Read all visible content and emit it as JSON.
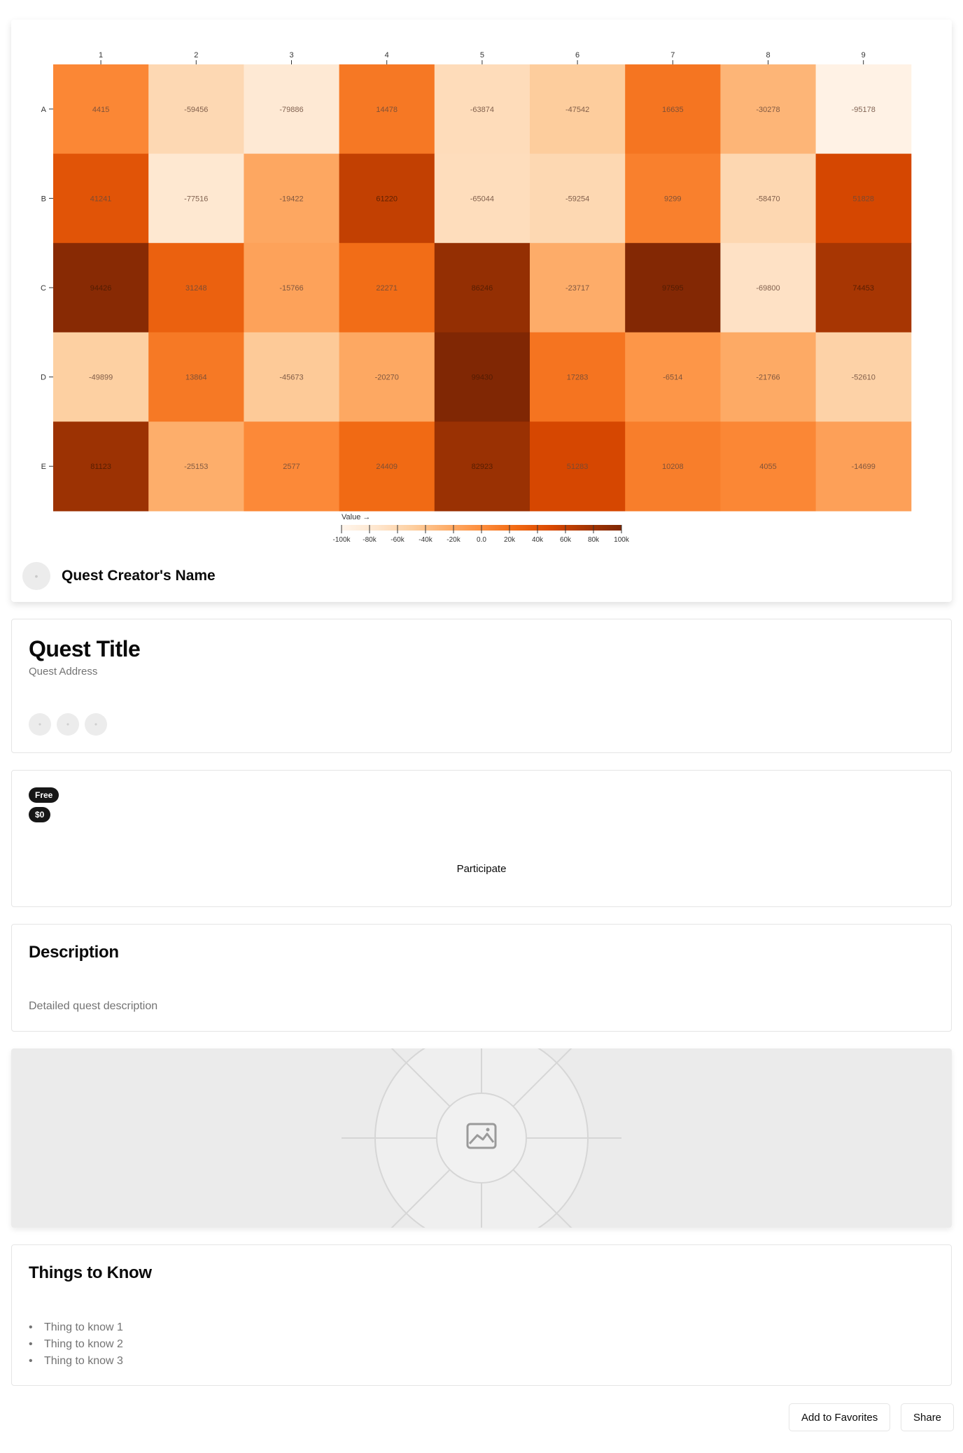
{
  "chart_data": {
    "type": "heatmap",
    "columns": [
      "1",
      "2",
      "3",
      "4",
      "5",
      "6",
      "7",
      "8",
      "9"
    ],
    "rows": [
      "A",
      "B",
      "C",
      "D",
      "E"
    ],
    "values": [
      [
        4415,
        -59456,
        -79886,
        14478,
        -63874,
        -47542,
        16635,
        -30278,
        -95178
      ],
      [
        41241,
        -77516,
        -19422,
        61220,
        -65044,
        -59254,
        9299,
        -58470,
        51828
      ],
      [
        94426,
        31248,
        -15766,
        22271,
        86246,
        -23717,
        97595,
        -69800,
        74453
      ],
      [
        -49899,
        13864,
        -45673,
        -20270,
        99430,
        17283,
        -6514,
        -21766,
        -52610
      ],
      [
        81123,
        -25153,
        2577,
        24409,
        82923,
        51283,
        10208,
        4055,
        -14699
      ]
    ],
    "zlim": [
      -100000,
      100000
    ],
    "legend": {
      "title": "Value →",
      "ticks": [
        "-100k",
        "-80k",
        "-60k",
        "-40k",
        "-20k",
        "0.0",
        "20k",
        "40k",
        "60k",
        "80k",
        "100k"
      ]
    },
    "colors": [
      "#fff5eb",
      "#fee6ce",
      "#fdd0a2",
      "#fdae6b",
      "#fd8d3c",
      "#f16913",
      "#d94801",
      "#a63603",
      "#7f2704"
    ]
  },
  "creator": {
    "name": "Quest Creator's Name",
    "avatar_icon": "user-avatar-icon"
  },
  "quest": {
    "title": "Quest Title",
    "address": "Quest Address"
  },
  "pricing": {
    "badge_free": "Free",
    "badge_price": "$0",
    "participate_label": "Participate"
  },
  "description": {
    "heading": "Description",
    "text": "Detailed quest description"
  },
  "image": {
    "icon": "image-icon"
  },
  "things_to_know": {
    "heading": "Things to Know",
    "items": [
      "Thing to know 1",
      "Thing to know 2",
      "Thing to know 3"
    ]
  },
  "actions": {
    "favorites_label": "Add to Favorites",
    "share_label": "Share"
  }
}
